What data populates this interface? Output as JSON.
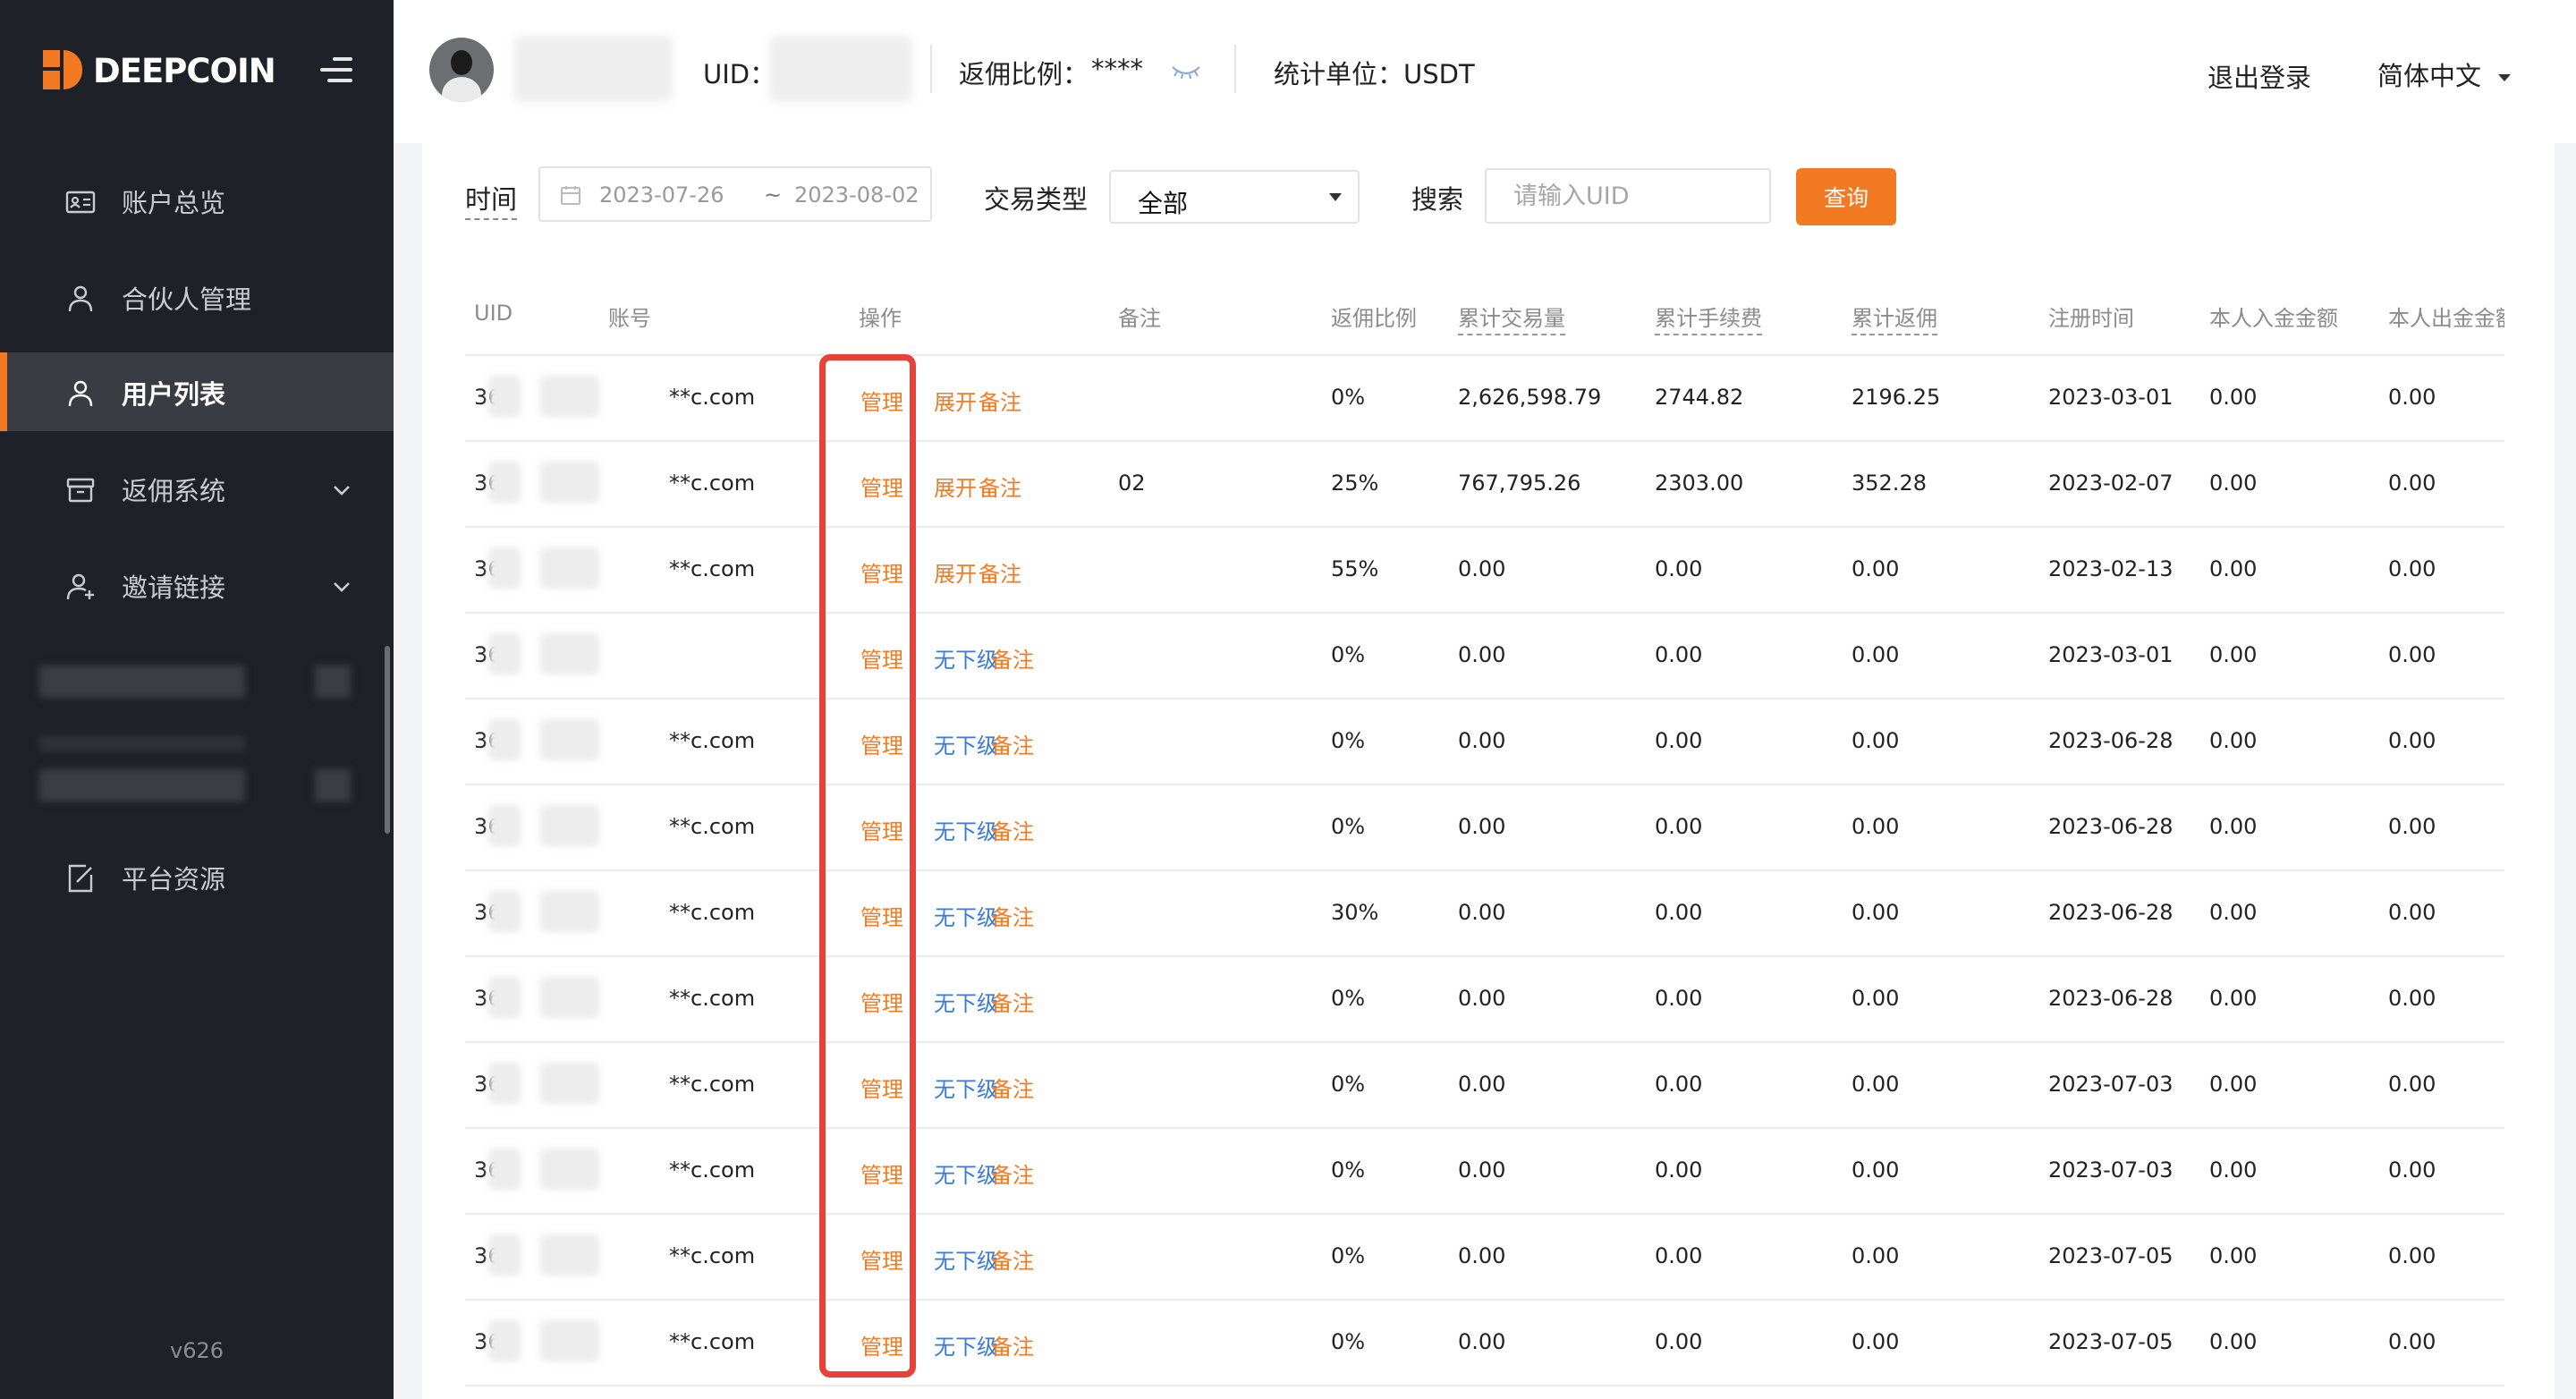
{
  "brand": {
    "name": "DEEPCOIN",
    "version": "v626"
  },
  "sidebar": {
    "items": [
      {
        "label": "账户总览",
        "icon": "account-card-icon",
        "active": false,
        "expandable": false
      },
      {
        "label": "合伙人管理",
        "icon": "partner-user-icon",
        "active": false,
        "expandable": false
      },
      {
        "label": "用户列表",
        "icon": "user-list-icon",
        "active": true,
        "expandable": false
      },
      {
        "label": "返佣系统",
        "icon": "rebate-box-icon",
        "active": false,
        "expandable": true
      },
      {
        "label": "邀请链接",
        "icon": "invite-user-icon",
        "active": false,
        "expandable": true
      },
      {
        "label": "平台资源",
        "icon": "resource-edit-icon",
        "active": false,
        "expandable": false
      }
    ]
  },
  "header": {
    "uid_label": "UID：",
    "rebate_ratio_label": "返佣比例：",
    "rebate_ratio_value": "****",
    "unit_label": "统计单位：USDT",
    "logout": "退出登录",
    "language": "简体中文"
  },
  "filters": {
    "time_label": "时间",
    "date_start": "2023-07-26",
    "date_sep": "~",
    "date_end": "2023-08-02",
    "trade_type_label": "交易类型",
    "trade_type_value": "全部",
    "search_label": "搜索",
    "search_placeholder": "请输入UID",
    "query_button": "查询"
  },
  "table": {
    "columns": [
      "UID",
      "账号",
      "操作",
      "备注",
      "返佣比例",
      "累计交易量",
      "累计手续费",
      "累计返佣",
      "注册时间",
      "本人入金金额",
      "本人出金金额"
    ],
    "manage_label": "管理",
    "remark_label": "备注",
    "rows": [
      {
        "uid": "36",
        "account": "**c.com",
        "sub": "展开",
        "remark": "",
        "ratio": "0%",
        "volume": "2,626,598.79",
        "fee": "2744.82",
        "rebate": "2196.25",
        "reg_date": "2023-03-01",
        "deposit": "0.00",
        "withdraw": "0.00"
      },
      {
        "uid": "36",
        "account": "**c.com",
        "sub": "展开",
        "remark": "02",
        "ratio": "25%",
        "volume": "767,795.26",
        "fee": "2303.00",
        "rebate": "352.28",
        "reg_date": "2023-02-07",
        "deposit": "0.00",
        "withdraw": "0.00"
      },
      {
        "uid": "36",
        "account": "**c.com",
        "sub": "展开",
        "remark": "",
        "ratio": "55%",
        "volume": "0.00",
        "fee": "0.00",
        "rebate": "0.00",
        "reg_date": "2023-02-13",
        "deposit": "0.00",
        "withdraw": "0.00"
      },
      {
        "uid": "36",
        "account": "",
        "sub": "无下级",
        "remark": "",
        "ratio": "0%",
        "volume": "0.00",
        "fee": "0.00",
        "rebate": "0.00",
        "reg_date": "2023-03-01",
        "deposit": "0.00",
        "withdraw": "0.00"
      },
      {
        "uid": "36",
        "account": "**c.com",
        "sub": "无下级",
        "remark": "",
        "ratio": "0%",
        "volume": "0.00",
        "fee": "0.00",
        "rebate": "0.00",
        "reg_date": "2023-06-28",
        "deposit": "0.00",
        "withdraw": "0.00"
      },
      {
        "uid": "36",
        "account": "**c.com",
        "sub": "无下级",
        "remark": "",
        "ratio": "0%",
        "volume": "0.00",
        "fee": "0.00",
        "rebate": "0.00",
        "reg_date": "2023-06-28",
        "deposit": "0.00",
        "withdraw": "0.00"
      },
      {
        "uid": "36",
        "account": "**c.com",
        "sub": "无下级",
        "remark": "",
        "ratio": "30%",
        "volume": "0.00",
        "fee": "0.00",
        "rebate": "0.00",
        "reg_date": "2023-06-28",
        "deposit": "0.00",
        "withdraw": "0.00"
      },
      {
        "uid": "36",
        "account": "**c.com",
        "sub": "无下级",
        "remark": "",
        "ratio": "0%",
        "volume": "0.00",
        "fee": "0.00",
        "rebate": "0.00",
        "reg_date": "2023-06-28",
        "deposit": "0.00",
        "withdraw": "0.00"
      },
      {
        "uid": "36",
        "account": "**c.com",
        "sub": "无下级",
        "remark": "",
        "ratio": "0%",
        "volume": "0.00",
        "fee": "0.00",
        "rebate": "0.00",
        "reg_date": "2023-07-03",
        "deposit": "0.00",
        "withdraw": "0.00"
      },
      {
        "uid": "36",
        "account": "**c.com",
        "sub": "无下级",
        "remark": "",
        "ratio": "0%",
        "volume": "0.00",
        "fee": "0.00",
        "rebate": "0.00",
        "reg_date": "2023-07-03",
        "deposit": "0.00",
        "withdraw": "0.00"
      },
      {
        "uid": "36",
        "account": "**c.com",
        "sub": "无下级",
        "remark": "",
        "ratio": "0%",
        "volume": "0.00",
        "fee": "0.00",
        "rebate": "0.00",
        "reg_date": "2023-07-05",
        "deposit": "0.00",
        "withdraw": "0.00"
      },
      {
        "uid": "36",
        "account": "**c.com",
        "sub": "无下级",
        "remark": "",
        "ratio": "0%",
        "volume": "0.00",
        "fee": "0.00",
        "rebate": "0.00",
        "reg_date": "2023-07-05",
        "deposit": "0.00",
        "withdraw": "0.00"
      }
    ]
  },
  "colors": {
    "accent": "#f27a23",
    "link_blue": "#3a7bd5",
    "highlight": "#e8413a",
    "sidebar_bg": "#1f2128"
  }
}
